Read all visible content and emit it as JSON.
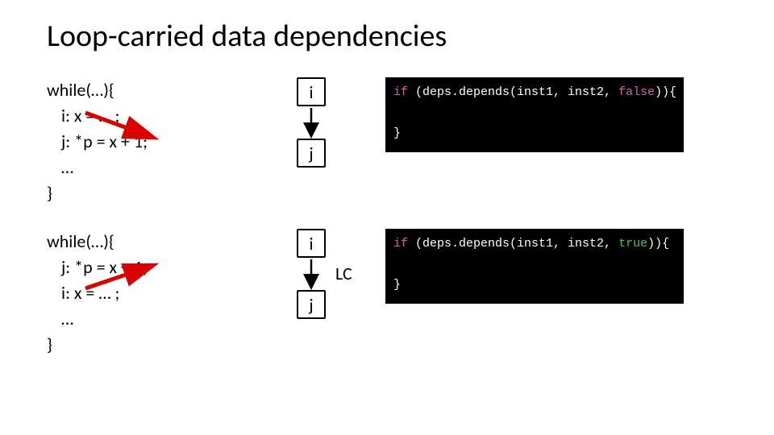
{
  "title": "Loop-carried data dependencies",
  "example1": {
    "code": {
      "l1": "while(…){",
      "l2": "i: x = … ;",
      "l3": "j: *p = x + 1;",
      "l4": "…",
      "l5": "}"
    },
    "diagram": {
      "top": "i",
      "bottom": "j",
      "lc": ""
    },
    "snippet": {
      "kw_if": "if",
      "mid": " (deps.depends(inst1, inst2, ",
      "bool": "false",
      "tail": ")){",
      "close": "}"
    }
  },
  "example2": {
    "code": {
      "l1": "while(…){",
      "l2": "j: *p = x + 1;",
      "l3": "i: x = … ;",
      "l4": "…",
      "l5": "}"
    },
    "diagram": {
      "top": "i",
      "bottom": "j",
      "lc": "LC"
    },
    "snippet": {
      "kw_if": "if",
      "mid": " (deps.depends(inst1, inst2, ",
      "bool": "true",
      "tail": ")){",
      "close": "}"
    }
  }
}
